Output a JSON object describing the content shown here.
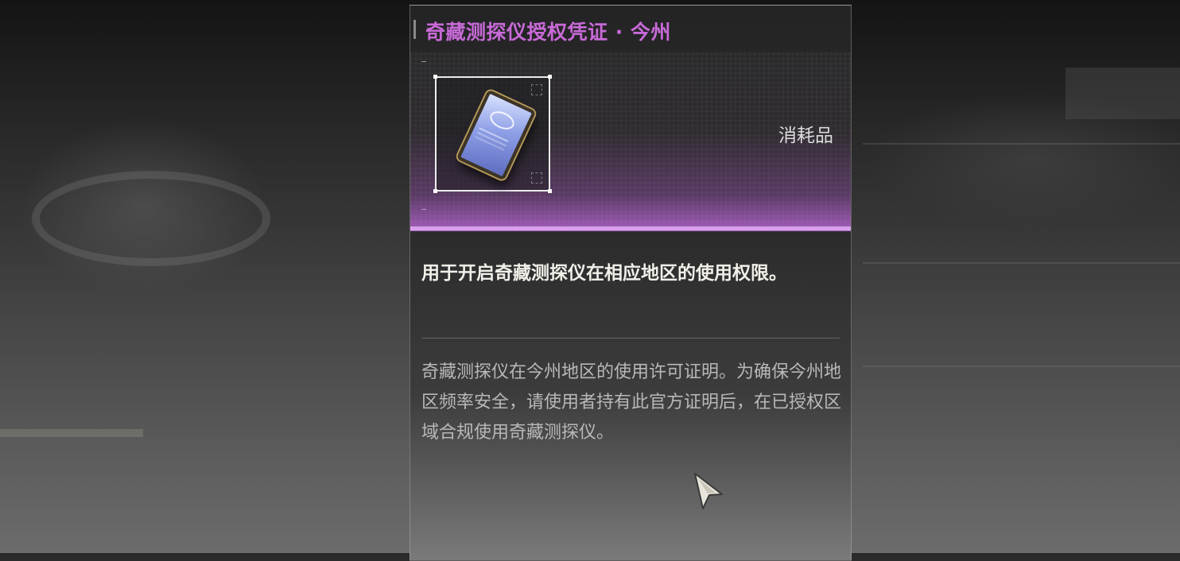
{
  "tooltip": {
    "title": "奇藏测探仪授权凭证 · 今州",
    "category": "消耗品",
    "summary": "用于开启奇藏测探仪在相应地区的使用权限。",
    "lore": "奇藏测探仪在今州地区的使用许可证明。为确保今州地区频率安全，请使用者持有此官方证明后，在已授权区域合规使用奇藏测探仪。",
    "item_icon": "authorization-voucher-card-icon",
    "rarity_color": "#c86ad8"
  },
  "cursor": {
    "icon": "mouse-pointer-icon"
  }
}
